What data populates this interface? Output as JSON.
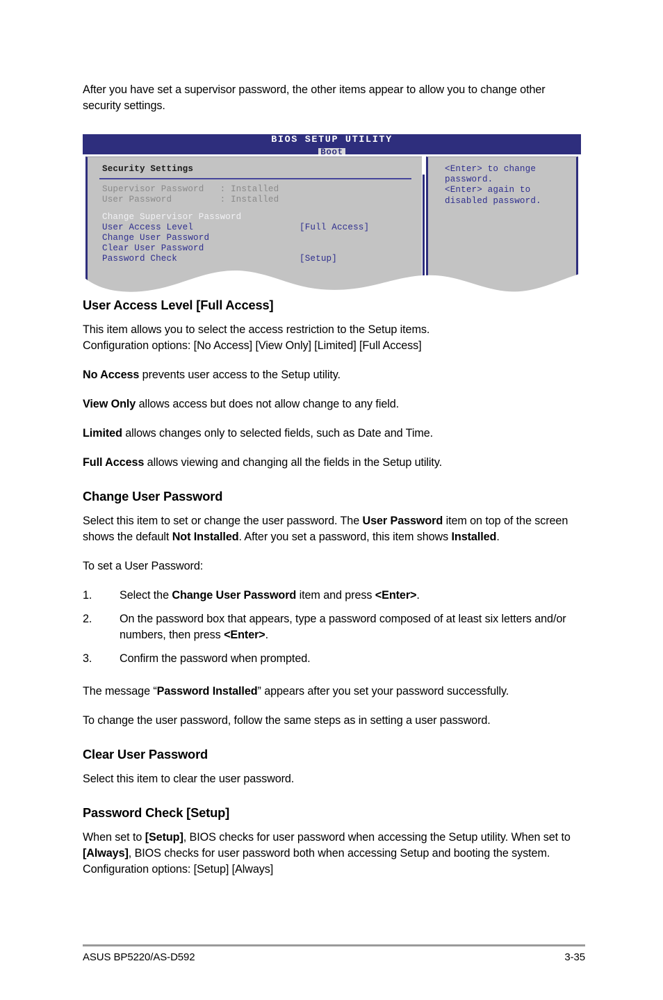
{
  "intro": {
    "paragraph": "After you have set a supervisor password, the other items appear to allow you to change other security settings."
  },
  "bios": {
    "title": "BIOS SETUP UTILITY",
    "tab": "Boot",
    "section_title": "Security Settings",
    "status_rows": [
      {
        "label": "Supervisor Password",
        "sep": ":",
        "value": "Installed"
      },
      {
        "label": "User Password",
        "sep": ":",
        "value": "Installed"
      }
    ],
    "status_line_1": "Supervisor Password   : Installed",
    "status_line_2": "User Password         : Installed",
    "items": [
      {
        "label": "Change Supervisor Password",
        "value": ""
      },
      {
        "label": "User Access Level",
        "value": "[Full Access]"
      },
      {
        "label": "Change User Password",
        "value": ""
      },
      {
        "label": "Clear User Password",
        "value": ""
      },
      {
        "label": "Password Check",
        "value": "[Setup]"
      }
    ],
    "help": "<Enter> to change\npassword.\n<Enter> again to\ndisabled password.",
    "colors": {
      "header_bg": "#2e2e7d",
      "panel_bg": "#c3c3c3",
      "item_text": "#2e2e8e",
      "highlight_text": "#f2f2f5",
      "status_text": "#8a8a8a"
    }
  },
  "sections": [
    {
      "heading": "User Access Level [Full Access]",
      "body_line_1": "This item allows you to select the access restriction to the Setup items.",
      "body_line_2": "Configuration options: [No Access] [View Only] [Limited] [Full Access]"
    },
    {
      "heading": "Change User Password"
    },
    {
      "heading": "Clear User Password",
      "body": "Select this item to clear the user password."
    },
    {
      "heading": "Password Check [Setup]"
    }
  ],
  "definitions": [
    {
      "term": "No Access",
      "rest": " prevents user access to the Setup utility."
    },
    {
      "term": "View Only",
      "rest": " allows access but does not allow change to any field."
    },
    {
      "term": "Limited",
      "rest": " allows changes only to selected fields, such as Date and Time."
    },
    {
      "term": "Full Access",
      "rest": " allows viewing and changing all the fields in the Setup utility."
    }
  ],
  "change_user_password": {
    "para_a_1": "Select this item to set or change the user password. The ",
    "para_a_b1": "User Password",
    "para_a_2": " item on top of the screen shows the default ",
    "para_a_b2": "Not Installed",
    "para_a_3": ". After you set a password, this item shows ",
    "para_a_b3": "Installed",
    "para_a_4": ".",
    "para_b": "To set a User Password:",
    "steps": [
      {
        "num": "1.",
        "t1": "Select the ",
        "b1": "Change User Password",
        "t2": " item and press ",
        "b2": "<Enter>",
        "t3": "."
      },
      {
        "num": "2.",
        "t1": "On the password box that appears, type a password composed of at least six letters and/or numbers, then press ",
        "b1": "",
        "t2": "",
        "b2": "<Enter>",
        "t3": "."
      },
      {
        "num": "3.",
        "t1": "Confirm the password when prompted.",
        "b1": "",
        "t2": "",
        "b2": "",
        "t3": ""
      }
    ],
    "para_c_1": "The message “",
    "para_c_b1": "Password Installed",
    "para_c_2": "” appears after you set your password successfully.",
    "para_d": "To change the user password, follow the same steps as in setting a user password."
  },
  "password_check": {
    "t1": "When set to ",
    "b1": "[Setup]",
    "t2": ", BIOS checks for user password when accessing the Setup utility. When set to ",
    "b2": "[Always]",
    "t3": ", BIOS checks for user password both when accessing Setup and booting the system. Configuration options: [Setup] [Always]"
  },
  "footer": {
    "left": "ASUS BP5220/AS-D592",
    "right": "3-35"
  }
}
